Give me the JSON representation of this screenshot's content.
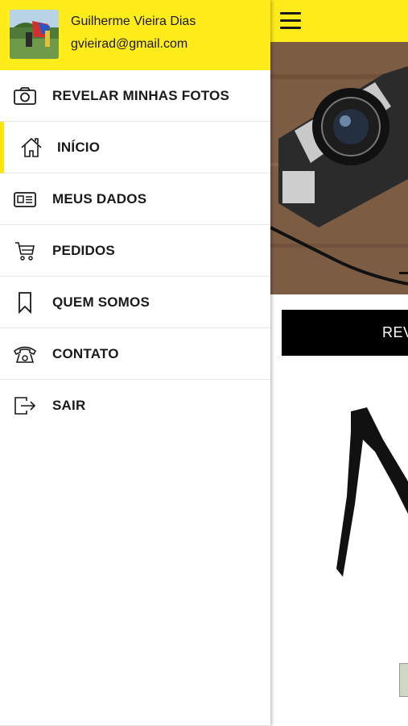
{
  "user": {
    "name": "Guilherme Vieira Dias",
    "email": "gvieirad@gmail.com"
  },
  "menu": {
    "items": [
      {
        "label": "REVELAR MINHAS FOTOS",
        "icon": "camera-icon"
      },
      {
        "label": "INÍCIO",
        "icon": "home-icon",
        "active": true
      },
      {
        "label": "MEUS DADOS",
        "icon": "id-card-icon"
      },
      {
        "label": "PEDIDOS",
        "icon": "cart-icon"
      },
      {
        "label": "QUEM SOMOS",
        "icon": "bookmark-icon"
      },
      {
        "label": "CONTATO",
        "icon": "telephone-icon"
      },
      {
        "label": "SAIR",
        "icon": "logout-icon"
      }
    ]
  },
  "main": {
    "cta_label": "REV",
    "icon": "hamburger-menu-icon"
  },
  "colors": {
    "accent": "#ffec1a",
    "text": "#1a1a1a",
    "cta_bg": "#000000"
  }
}
